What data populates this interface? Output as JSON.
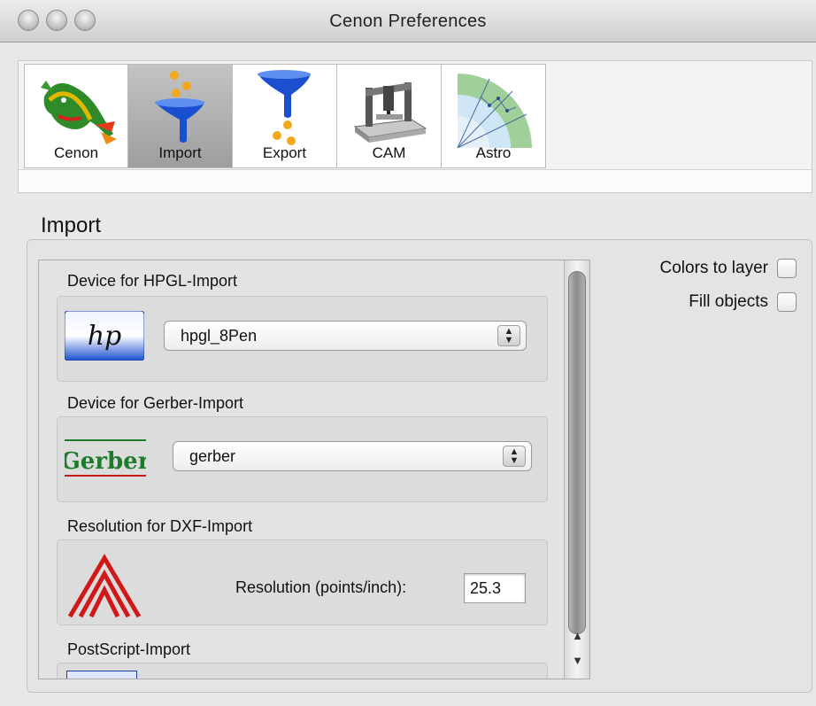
{
  "window": {
    "title": "Cenon Preferences"
  },
  "toolbar": {
    "items": [
      {
        "label": "Cenon",
        "icon": "dragon-icon",
        "selected": false
      },
      {
        "label": "Import",
        "icon": "import-funnel-icon",
        "selected": true
      },
      {
        "label": "Export",
        "icon": "export-funnel-icon",
        "selected": false
      },
      {
        "label": "CAM",
        "icon": "cnc-machine-icon",
        "selected": false
      },
      {
        "label": "Astro",
        "icon": "astro-chart-icon",
        "selected": false
      }
    ]
  },
  "section": {
    "title": "Import"
  },
  "hpgl": {
    "label": "Device for HPGL-Import",
    "logo": "hp",
    "selected": "hpgl_8Pen"
  },
  "gerber": {
    "label": "Device for Gerber-Import",
    "logo": "Gerber",
    "selected": "gerber"
  },
  "dxf": {
    "label": "Resolution for DXF-Import",
    "field_label": "Resolution (points/inch):",
    "value": "25.3"
  },
  "postscript": {
    "label": "PostScript-Import"
  },
  "options": {
    "colors_to_layer": {
      "label": "Colors to layer",
      "checked": false
    },
    "fill_objects": {
      "label": "Fill objects",
      "checked": false
    }
  },
  "colors": {
    "accent_blue": "#1a4fd0",
    "gerber_green": "#1d7b2b",
    "dxf_red": "#d01818"
  }
}
